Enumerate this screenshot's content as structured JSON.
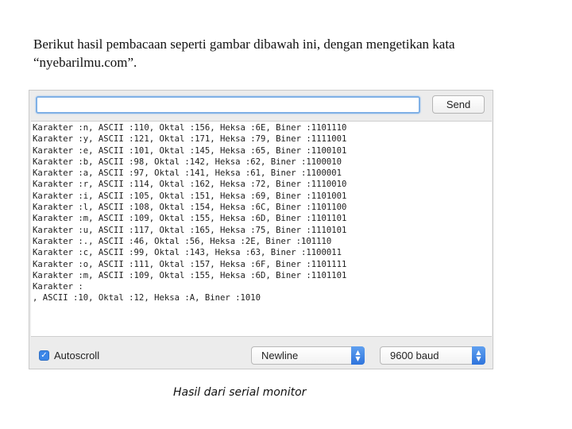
{
  "intro": {
    "line1": "Berikut hasil pembacaan seperti gambar dibawah ini, dengan mengetikan kata",
    "line2": "“nyebarilmu.com”."
  },
  "monitor": {
    "input_value": "",
    "send_label": "Send",
    "output_lines": [
      "Karakter :n, ASCII :110, Oktal :156, Heksa :6E, Biner :1101110",
      "Karakter :y, ASCII :121, Oktal :171, Heksa :79, Biner :1111001",
      "Karakter :e, ASCII :101, Oktal :145, Heksa :65, Biner :1100101",
      "Karakter :b, ASCII :98, Oktal :142, Heksa :62, Biner :1100010",
      "Karakter :a, ASCII :97, Oktal :141, Heksa :61, Biner :1100001",
      "Karakter :r, ASCII :114, Oktal :162, Heksa :72, Biner :1110010",
      "Karakter :i, ASCII :105, Oktal :151, Heksa :69, Biner :1101001",
      "Karakter :l, ASCII :108, Oktal :154, Heksa :6C, Biner :1101100",
      "Karakter :m, ASCII :109, Oktal :155, Heksa :6D, Biner :1101101",
      "Karakter :u, ASCII :117, Oktal :165, Heksa :75, Biner :1110101",
      "Karakter :., ASCII :46, Oktal :56, Heksa :2E, Biner :101110",
      "Karakter :c, ASCII :99, Oktal :143, Heksa :63, Biner :1100011",
      "Karakter :o, ASCII :111, Oktal :157, Heksa :6F, Biner :1101111",
      "Karakter :m, ASCII :109, Oktal :155, Heksa :6D, Biner :1101101",
      "Karakter :",
      ", ASCII :10, Oktal :12, Heksa :A, Biner :1010"
    ],
    "autoscroll_label": "Autoscroll",
    "autoscroll_checked": true,
    "line_ending": "Newline",
    "baud_rate": "9600 baud",
    "accent_color": "#3b86e8"
  },
  "caption": "Hasil dari serial monitor"
}
